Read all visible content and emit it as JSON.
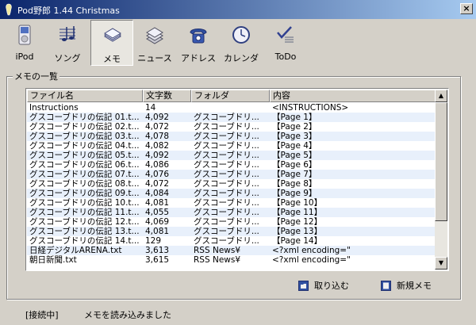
{
  "window": {
    "title": "Pod野郎 1.44 Christmas",
    "close_label": "×"
  },
  "toolbar": {
    "items": [
      {
        "label": "iPod",
        "icon": "ipod-icon"
      },
      {
        "label": "ソング",
        "icon": "music-icon"
      },
      {
        "label": "メモ",
        "icon": "memo-icon",
        "active": true
      },
      {
        "label": "ニュース",
        "icon": "news-icon"
      },
      {
        "label": "アドレス",
        "icon": "phone-icon"
      },
      {
        "label": "カレンダ",
        "icon": "clock-icon"
      },
      {
        "label": "ToDo",
        "icon": "todo-icon"
      }
    ]
  },
  "group": {
    "label": "メモの一覧"
  },
  "table": {
    "columns": [
      "ファイル名",
      "文字数",
      "フォルダ",
      "内容"
    ],
    "rows": [
      [
        "Instructions",
        "14",
        "",
        "<INSTRUCTIONS>"
      ],
      [
        "グスコーブドリの伝記 01.t...",
        "4,092",
        "グスコーブドリ...",
        "【Page 1】"
      ],
      [
        "グスコーブドリの伝記 02.t...",
        "4,072",
        "グスコーブドリ...",
        "【Page 2】"
      ],
      [
        "グスコーブドリの伝記 03.t...",
        "4,078",
        "グスコーブドリ...",
        "【Page 3】"
      ],
      [
        "グスコーブドリの伝記 04.t...",
        "4,082",
        "グスコーブドリ...",
        "【Page 4】"
      ],
      [
        "グスコーブドリの伝記 05.t...",
        "4,092",
        "グスコーブドリ...",
        "【Page 5】"
      ],
      [
        "グスコーブドリの伝記 06.t...",
        "4,086",
        "グスコーブドリ...",
        "【Page 6】"
      ],
      [
        "グスコーブドリの伝記 07.t...",
        "4,076",
        "グスコーブドリ...",
        "【Page 7】"
      ],
      [
        "グスコーブドリの伝記 08.t...",
        "4,072",
        "グスコーブドリ...",
        "【Page 8】"
      ],
      [
        "グスコーブドリの伝記 09.t...",
        "4,084",
        "グスコーブドリ...",
        "【Page 9】"
      ],
      [
        "グスコーブドリの伝記 10.t...",
        "4,081",
        "グスコーブドリ...",
        "【Page 10】"
      ],
      [
        "グスコーブドリの伝記 11.t...",
        "4,055",
        "グスコーブドリ...",
        "【Page 11】"
      ],
      [
        "グスコーブドリの伝記 12.t...",
        "4,069",
        "グスコーブドリ...",
        "【Page 12】"
      ],
      [
        "グスコーブドリの伝記 13.t...",
        "4,081",
        "グスコーブドリ...",
        "【Page 13】"
      ],
      [
        "グスコーブドリの伝記 14.t...",
        "129",
        "グスコーブドリ...",
        "【Page 14】"
      ],
      [
        "日経デジタルARENA.txt",
        "3,613",
        "RSS News¥",
        "<?xml encoding=\""
      ],
      [
        "朝日新聞.txt",
        "3,615",
        "RSS News¥",
        "<?xml encoding=\""
      ]
    ]
  },
  "buttons": {
    "import_label": "取り込む",
    "new_memo_label": "新規メモ"
  },
  "status": {
    "connection": "[接続中]",
    "message": "メモを読み込みました"
  },
  "colors": {
    "title_start": "#0a246a",
    "title_end": "#a6caf0",
    "alt_row": "#e8f0fb",
    "face": "#d4d0c8"
  }
}
